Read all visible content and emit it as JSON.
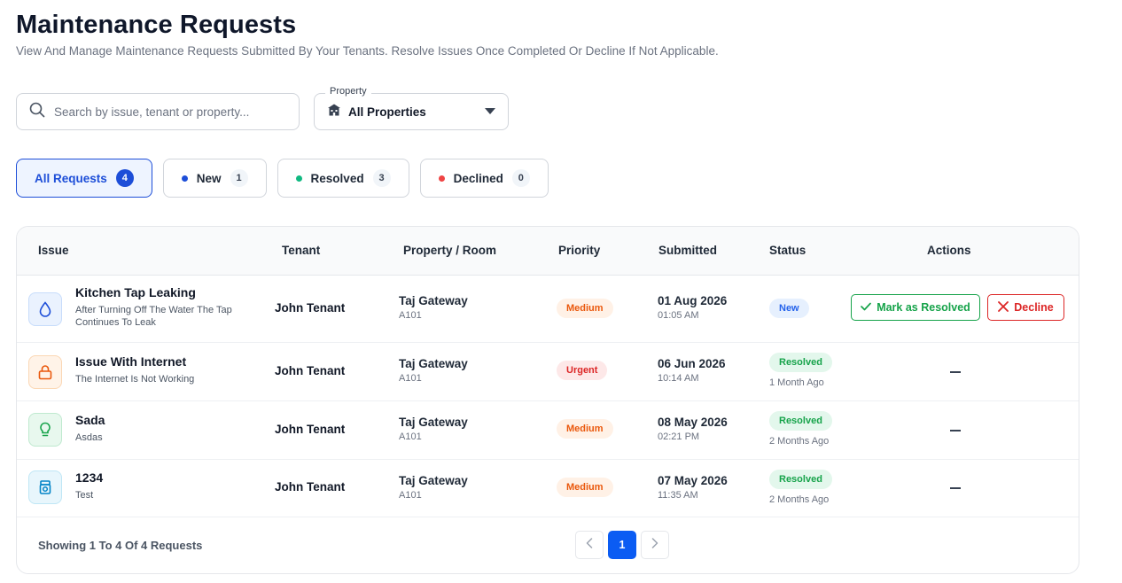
{
  "header": {
    "title": "Maintenance Requests",
    "subtitle": "View And Manage Maintenance Requests Submitted By Your Tenants. Resolve Issues Once Completed Or Decline If Not Applicable."
  },
  "filters": {
    "search_placeholder": "Search by issue, tenant or property...",
    "property_label": "Property",
    "property_value": "All Properties"
  },
  "tabs": [
    {
      "label": "All Requests",
      "count": "4",
      "active": true
    },
    {
      "label": "New",
      "count": "1",
      "dot_color": "#1d4ed8"
    },
    {
      "label": "Resolved",
      "count": "3",
      "dot_color": "#10b981"
    },
    {
      "label": "Declined",
      "count": "0",
      "dot_color": "#ef4444"
    }
  ],
  "table": {
    "columns": [
      "Issue",
      "Tenant",
      "Property / Room",
      "Priority",
      "Submitted",
      "Status",
      "Actions"
    ],
    "rows": [
      {
        "icon": "water-drop-icon",
        "title": "Kitchen Tap Leaking",
        "description": "After Turning Off The Water The Tap Continues To Leak",
        "tenant": "John Tenant",
        "property": "Taj Gateway",
        "room": "A101",
        "priority": "Medium",
        "date": "01 Aug 2026",
        "time": "01:05 AM",
        "status": "New",
        "status_ago": "",
        "actions": {
          "resolve": "Mark as Resolved",
          "decline": "Decline"
        }
      },
      {
        "icon": "lock-icon",
        "title": "Issue With Internet",
        "description": "The Internet Is Not Working",
        "tenant": "John Tenant",
        "property": "Taj Gateway",
        "room": "A101",
        "priority": "Urgent",
        "date": "06 Jun 2026",
        "time": "10:14 AM",
        "status": "Resolved",
        "status_ago": "1 Month Ago"
      },
      {
        "icon": "lightbulb-icon",
        "title": "Sada",
        "description": "Asdas",
        "tenant": "John Tenant",
        "property": "Taj Gateway",
        "room": "A101",
        "priority": "Medium",
        "date": "08 May 2026",
        "time": "02:21 PM",
        "status": "Resolved",
        "status_ago": "2 Months Ago"
      },
      {
        "icon": "appliance-icon",
        "title": "1234",
        "description": "Test",
        "tenant": "John Tenant",
        "property": "Taj Gateway",
        "room": "A101",
        "priority": "Medium",
        "date": "07 May 2026",
        "time": "11:35 AM",
        "status": "Resolved",
        "status_ago": "2 Months Ago"
      }
    ]
  },
  "footer": {
    "showing_text": "Showing 1 To 4 Of 4 Requests",
    "current_page": "1"
  },
  "colors": {
    "primary": "#0b5cf3",
    "resolved": "#16a34a",
    "declined": "#dc2626",
    "medium": "#ea580c"
  }
}
